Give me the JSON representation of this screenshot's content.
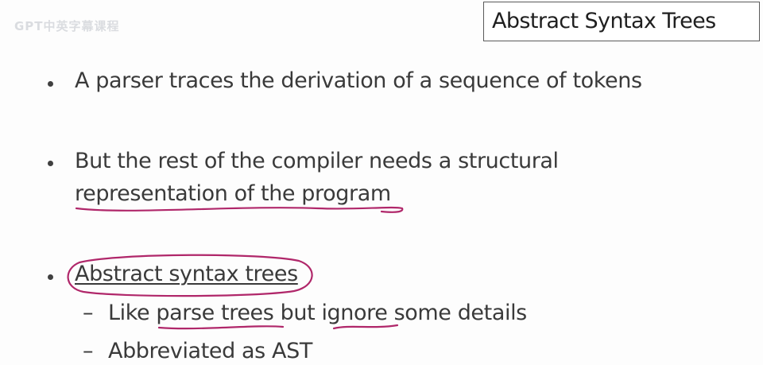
{
  "watermark": {
    "text": "GPT中英字幕课程"
  },
  "title": "Abstract Syntax Trees",
  "bullets": [
    {
      "text": "A parser traces the derivation of a sequence of tokens"
    },
    {
      "line1": "But the rest of the compiler needs a structural",
      "line2": "representation of the program"
    },
    {
      "text": "Abstract syntax trees"
    }
  ],
  "sub_bullets": [
    {
      "text": "Like parse trees but ignore some details"
    },
    {
      "text": "Abbreviated as AST"
    }
  ],
  "dash_glyph": "–",
  "colors": {
    "annotation_ink": "#b0276a",
    "text": "#3a3a3a",
    "title_border": "#5a5a5a"
  }
}
